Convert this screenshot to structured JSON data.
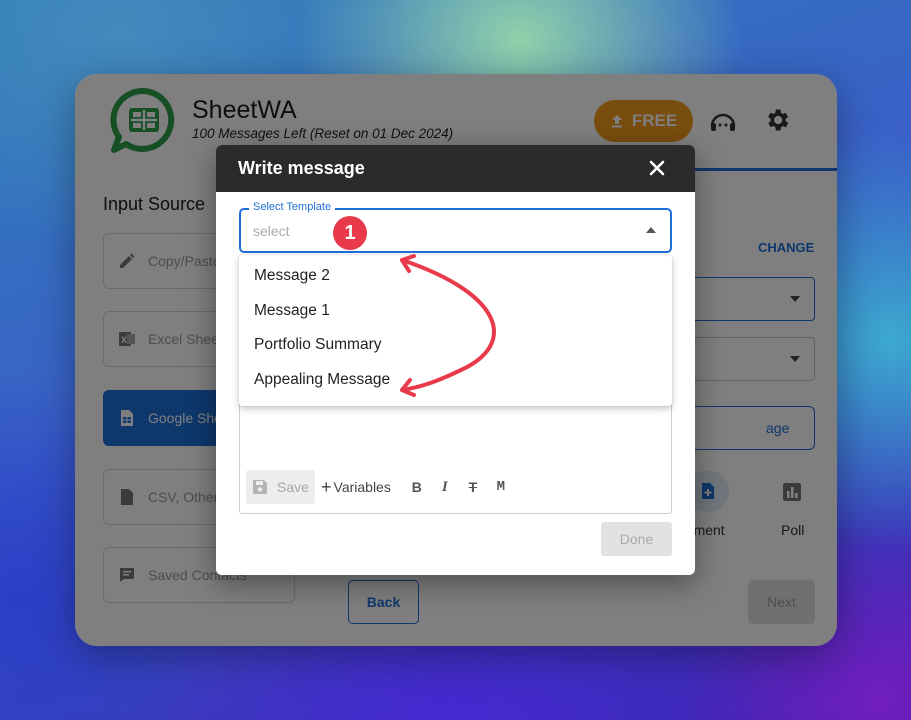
{
  "app": {
    "title": "SheetWA",
    "subtitle": "100 Messages Left (Reset on 01 Dec 2024)",
    "free_label": "FREE"
  },
  "sidebar": {
    "title": "Input Source",
    "items": [
      {
        "label": "Copy/Paste",
        "icon": "pencil-icon"
      },
      {
        "label": "Excel Sheet",
        "icon": "excel-icon"
      },
      {
        "label": "Google Sheet",
        "icon": "google-sheet-icon"
      },
      {
        "label": "CSV, Other",
        "icon": "file-icon"
      },
      {
        "label": "Saved Contacts",
        "icon": "contacts-icon"
      }
    ]
  },
  "main": {
    "change_label": "CHANGE",
    "message_button_label": "age",
    "document_label": "ocument",
    "poll_label": "Poll",
    "back_label": "Back",
    "next_label": "Next"
  },
  "dialog": {
    "title": "Write message",
    "template_label": "Select Template",
    "template_placeholder": "select",
    "step_number": "1",
    "options": [
      "Message 2",
      "Message 1",
      "Portfolio Summary",
      "Appealing Message"
    ],
    "toolbar": {
      "save_label": "Save",
      "variables_label": "Variables",
      "bold_label": "B",
      "italic_label": "I",
      "strike_label": "T",
      "mono_label": "M"
    },
    "done_label": "Done"
  },
  "colors": {
    "accent": "#1c6fd8",
    "free_button": "#f29a1a",
    "brand_green": "#2f9e4a",
    "annotation_red": "#e83a4a"
  }
}
